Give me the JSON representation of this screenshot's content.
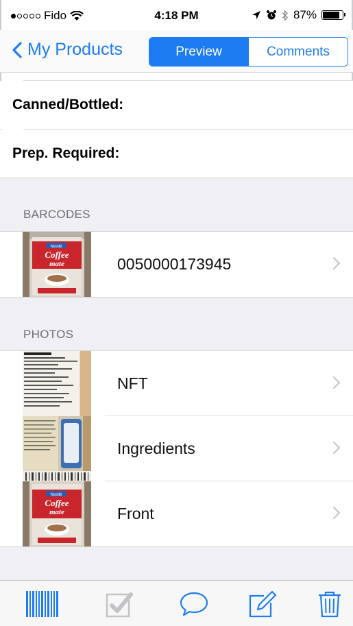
{
  "status_bar": {
    "carrier": "Fido",
    "time": "4:18 PM",
    "battery_percent": "87%",
    "battery_level": 0.87,
    "signal_bars_filled": 1,
    "signal_bars_total": 5
  },
  "nav": {
    "back_label": "My Products",
    "segments": [
      {
        "label": "Preview",
        "selected": true
      },
      {
        "label": "Comments",
        "selected": false
      }
    ]
  },
  "fields": {
    "canned_label": "Canned/Bottled:",
    "prep_label": "Prep. Required:"
  },
  "barcodes": {
    "header": "BARCODES",
    "items": [
      {
        "value": "0050000173945",
        "thumb": "coffee-mate-can"
      }
    ]
  },
  "photos": {
    "header": "PHOTOS",
    "items": [
      {
        "label": "NFT",
        "thumb": "nutrition-facts-label"
      },
      {
        "label": "Ingredients",
        "thumb": "ingredients-label"
      },
      {
        "label": "Front",
        "thumb": "coffee-mate-can"
      }
    ]
  },
  "toolbar": {
    "icons": [
      "barcode-icon",
      "checkmark-icon",
      "comment-bubble-icon",
      "edit-icon",
      "trash-icon"
    ]
  },
  "colors": {
    "accent": "#1e7cf2",
    "group_background": "#efeff4",
    "section_header_text": "#6d6d72",
    "chevron": "#c7c7cc",
    "coffee_mate_red": "#c8262c",
    "nestle_blue": "#2a5db0"
  }
}
